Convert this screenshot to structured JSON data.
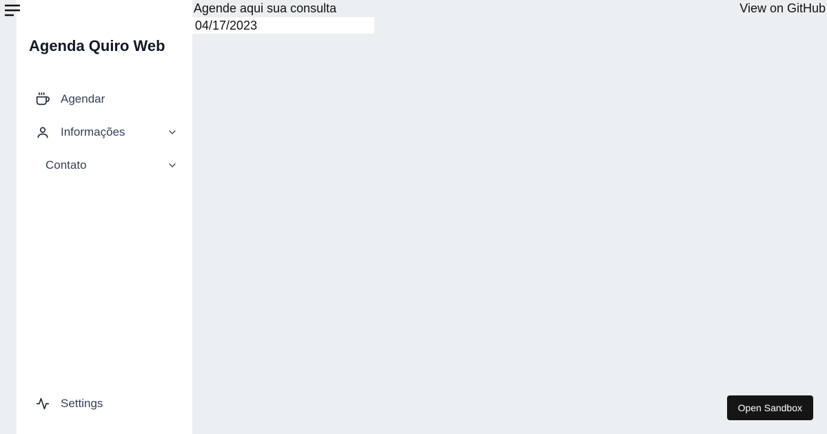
{
  "brand": "Agenda Quiro Web",
  "sidebar": {
    "items": [
      {
        "label": "Agendar"
      },
      {
        "label": "Informações"
      },
      {
        "label": "Contato"
      }
    ],
    "footer": {
      "label": "Settings"
    }
  },
  "main": {
    "header": "Agende aqui sua consulta",
    "date_value": "04/17/2023"
  },
  "top_link": "View on GitHub",
  "sandbox_button": "Open Sandbox"
}
